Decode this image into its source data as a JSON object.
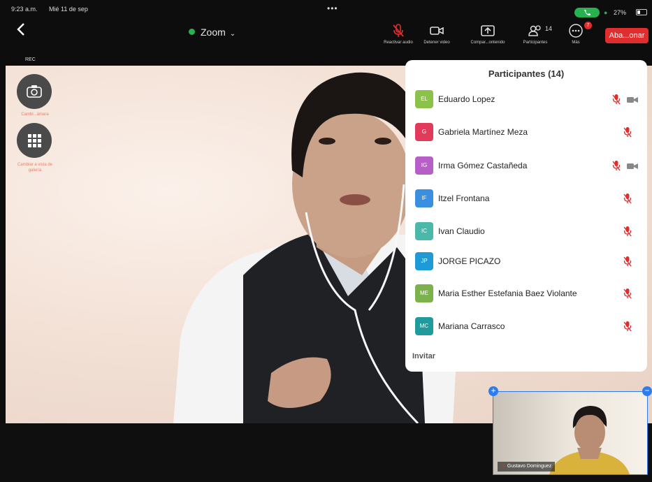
{
  "status_bar": {
    "time": "9:23 a.m.",
    "date": "Mié 11 de sep",
    "battery": "27%"
  },
  "toolbar": {
    "title": "Zoom",
    "audio_label": "Reactivar audio",
    "video_label": "Detener video",
    "share_label": "Compar...ontenido",
    "participants_label": "Participantes",
    "participants_count": "14",
    "more_label": "Más",
    "more_badge": "7",
    "leave_label": "Aba...onar"
  },
  "side": {
    "rec": "REC",
    "camera_label": "Cambi...ámara",
    "gallery_label": "Cambiar a vista de galería"
  },
  "panel": {
    "title": "Participantes (14)",
    "participants": [
      {
        "initials": "EL",
        "name": "Eduardo Lopez",
        "color": "#8bc34a",
        "video": true
      },
      {
        "initials": "G",
        "name": "Gabriela Martínez Meza",
        "color": "#e23a5b",
        "video": false
      },
      {
        "initials": "IG",
        "name": "Irma Gómez Castañeda",
        "color": "#b65fc6",
        "video": true
      },
      {
        "initials": "IF",
        "name": "Itzel Frontana",
        "color": "#3a8fe0",
        "video": false
      },
      {
        "initials": "IC",
        "name": "Ivan Claudio",
        "color": "#4bb8a9",
        "video": false
      },
      {
        "initials": "JP",
        "name": "JORGE PICAZO",
        "color": "#1e9bd7",
        "video": false
      },
      {
        "initials": "ME",
        "name": "Maria Esther Estefania Baez Violante",
        "color": "#7cb24b",
        "video": false
      },
      {
        "initials": "MC",
        "name": "Mariana Carrasco",
        "color": "#1f9b9b",
        "video": false
      }
    ],
    "invite": "Invitar"
  },
  "thumbnail": {
    "name": "Gustavo Dominguez"
  },
  "colors": {
    "leave": "#e02d2d",
    "mic_muted": "#e02d2d",
    "accent": "#2c7cf0"
  }
}
